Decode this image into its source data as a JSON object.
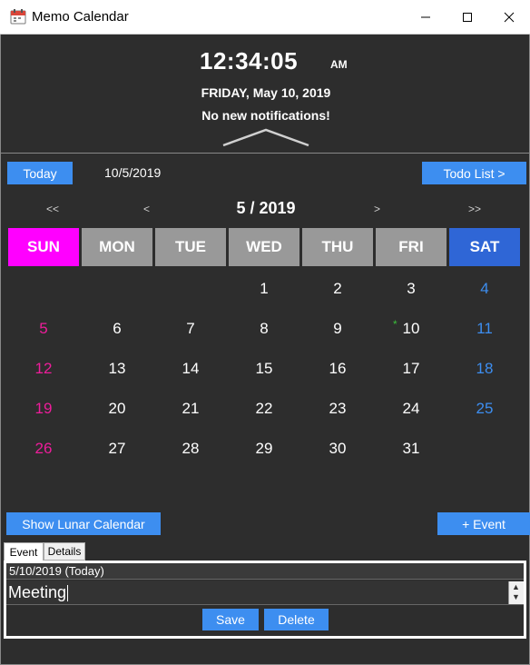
{
  "window": {
    "title": "Memo Calendar",
    "icon": "calendar-icon"
  },
  "header": {
    "time": "12:34:05",
    "ampm": "AM",
    "date": "FRIDAY, May 10, 2019",
    "notification": "No new notifications!"
  },
  "toolbar": {
    "today_label": "Today",
    "selected_date": "10/5/2019",
    "todo_label": "Todo List >"
  },
  "nav": {
    "prev_year": "<<",
    "prev_month": "<",
    "title": "5 / 2019",
    "next_month": ">",
    "next_year": ">>"
  },
  "weekdays": [
    "SUN",
    "MON",
    "TUE",
    "WED",
    "THU",
    "FRI",
    "SAT"
  ],
  "colors": {
    "accent": "#3d8ef0",
    "sunday": "#ee1d9b",
    "saturday_header": "#2f66d6",
    "weekday_header": "#999999",
    "event_marker": "#3bbf3b"
  },
  "weeks": [
    [
      "",
      "",
      "",
      "1",
      "2",
      "3",
      "4"
    ],
    [
      "5",
      "6",
      "7",
      "8",
      "9",
      "10",
      "11"
    ],
    [
      "12",
      "13",
      "14",
      "15",
      "16",
      "17",
      "18"
    ],
    [
      "19",
      "20",
      "21",
      "22",
      "23",
      "24",
      "25"
    ],
    [
      "26",
      "27",
      "28",
      "29",
      "30",
      "31",
      ""
    ]
  ],
  "event_marker_char": "*",
  "actions": {
    "lunar_label": "Show Lunar Calendar",
    "add_event_label": "+ Event"
  },
  "tabs": [
    "Event",
    "Details"
  ],
  "editor": {
    "date_header": "5/10/2019 (Today)",
    "text": "Meeting",
    "save_label": "Save",
    "delete_label": "Delete"
  }
}
